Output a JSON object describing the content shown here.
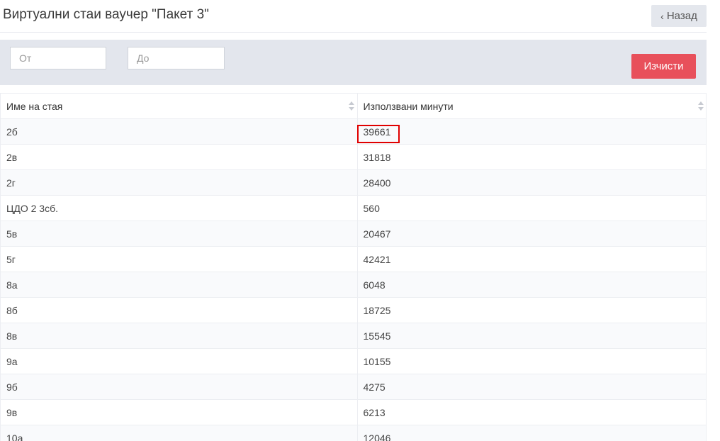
{
  "header": {
    "title": "Виртуални стаи ваучер \"Пакет 3\"",
    "back_label": "Назад"
  },
  "filters": {
    "from_placeholder": "От",
    "to_placeholder": "До",
    "clear_label": "Изчисти"
  },
  "table": {
    "columns": [
      "Име на стая",
      "Използвани минути"
    ],
    "rows": [
      [
        "2б",
        "39661"
      ],
      [
        "2в",
        "31818"
      ],
      [
        "2г",
        "28400"
      ],
      [
        "ЦДО 2 3сб.",
        "560"
      ],
      [
        "5в",
        "20467"
      ],
      [
        "5г",
        "42421"
      ],
      [
        "8а",
        "6048"
      ],
      [
        "8б",
        "18725"
      ],
      [
        "8в",
        "15545"
      ],
      [
        "9а",
        "10155"
      ],
      [
        "9б",
        "4275"
      ],
      [
        "9в",
        "6213"
      ],
      [
        "10а",
        "12046"
      ]
    ]
  },
  "colors": {
    "accent": "#e8505b",
    "highlight": "#e00000",
    "filter_bg": "#e3e6ed"
  }
}
